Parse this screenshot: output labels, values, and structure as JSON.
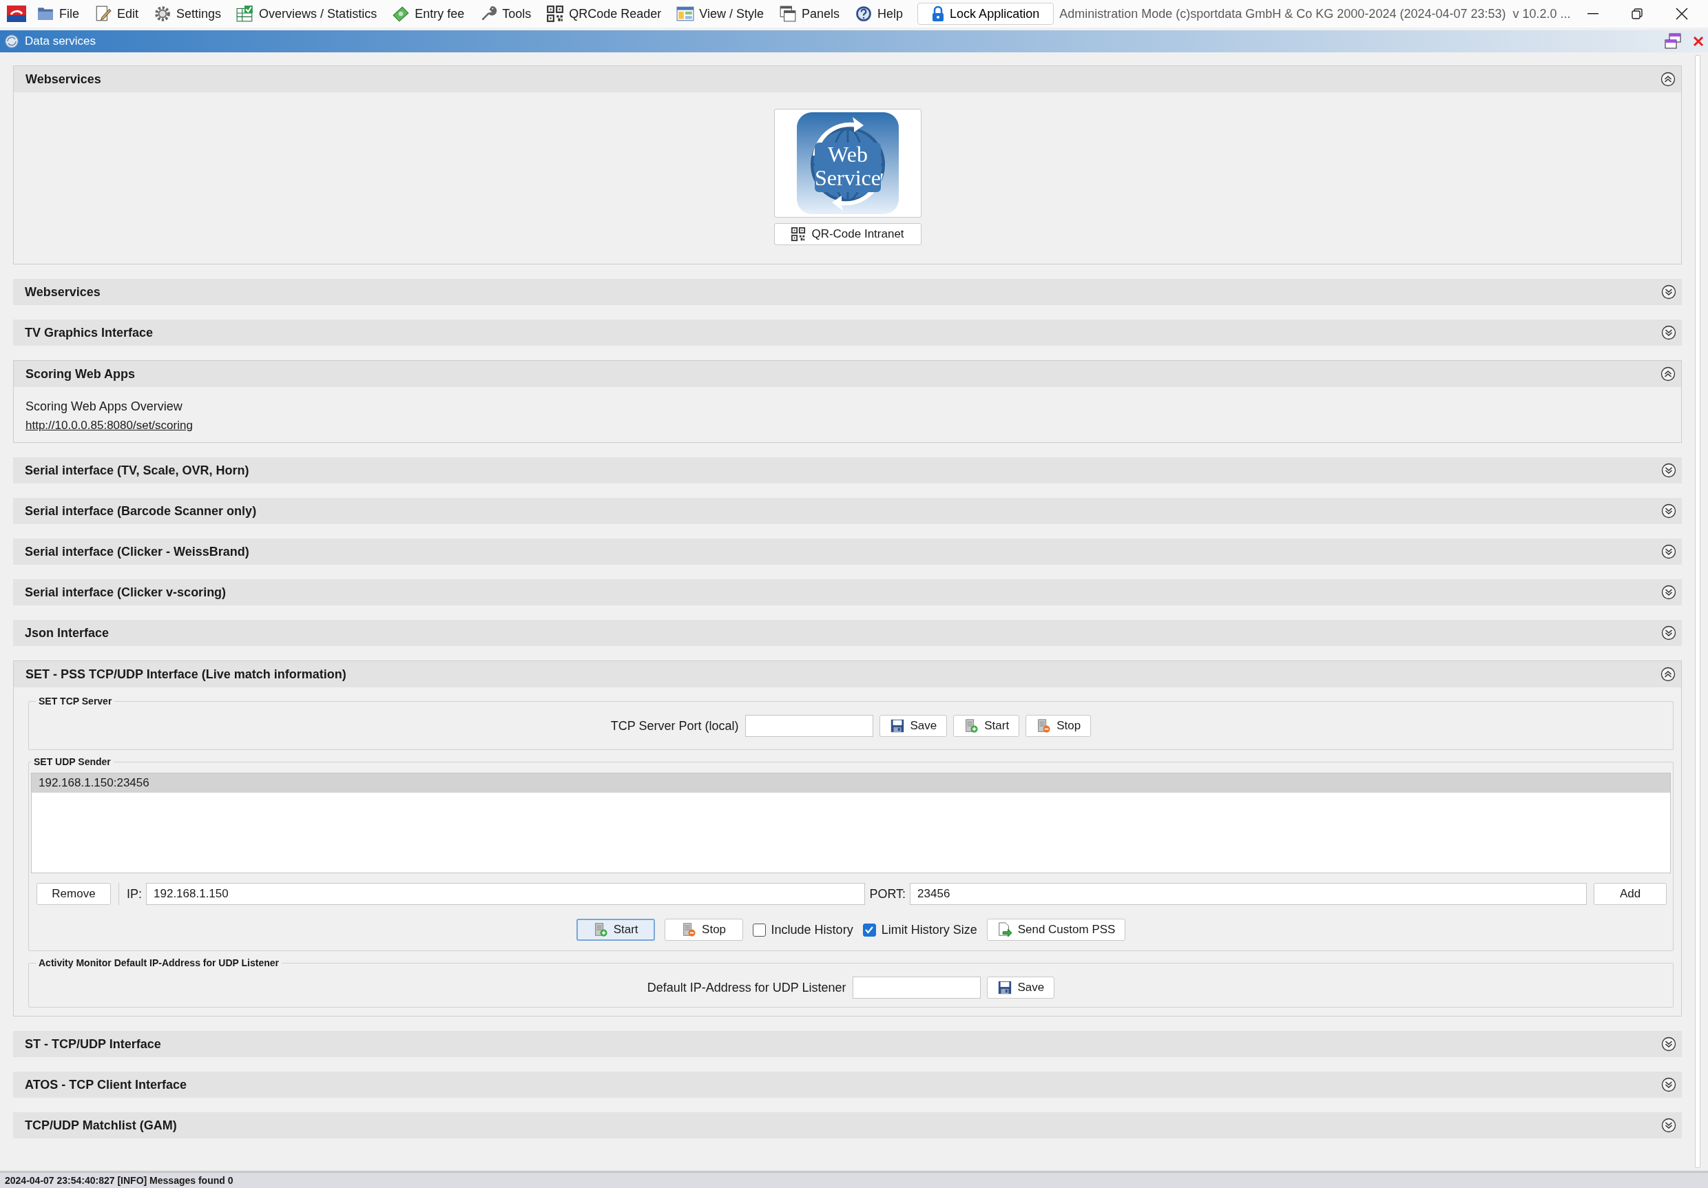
{
  "menu": [
    {
      "label": "File"
    },
    {
      "label": "Edit"
    },
    {
      "label": "Settings"
    },
    {
      "label": "Overviews / Statistics"
    },
    {
      "label": "Entry fee"
    },
    {
      "label": "Tools"
    },
    {
      "label": "QRCode Reader"
    },
    {
      "label": "View / Style"
    },
    {
      "label": "Panels"
    },
    {
      "label": "Help"
    }
  ],
  "lock_button": "Lock Application",
  "window": {
    "title": "Administration Mode (c)sportdata GmbH & Co KG 2000-2024 (2024-04-07 23:53)  v 10.2.0 ..."
  },
  "panel": {
    "title": "Data services"
  },
  "sections": [
    {
      "title": "Webservices",
      "expanded": true,
      "kind": "logo",
      "logo_lines": [
        "Web",
        "Service"
      ],
      "qr_button": "QR-Code Intranet"
    },
    {
      "title": "Webservices",
      "expanded": false
    },
    {
      "title": "TV Graphics Interface",
      "expanded": false
    },
    {
      "title": "Scoring Web Apps",
      "expanded": true,
      "kind": "links",
      "label": "Scoring Web Apps Overview",
      "link": "http://10.0.0.85:8080/set/scoring"
    },
    {
      "title": "Serial interface (TV, Scale, OVR, Horn)",
      "expanded": false
    },
    {
      "title": "Serial interface (Barcode Scanner only)",
      "expanded": false
    },
    {
      "title": "Serial interface (Clicker - WeissBrand)",
      "expanded": false
    },
    {
      "title": "Serial interface (Clicker v-scoring)",
      "expanded": false
    },
    {
      "title": "Json Interface",
      "expanded": false
    },
    {
      "title": "SET - PSS TCP/UDP Interface (Live match information)",
      "expanded": true,
      "kind": "pss",
      "tcp_server": {
        "title": "SET TCP Server",
        "port_label": "TCP Server Port (local)",
        "buttons": [
          {
            "label": "Save",
            "kind": "save"
          },
          {
            "label": "Start",
            "kind": "start"
          },
          {
            "label": "Stop",
            "kind": "stop"
          }
        ]
      },
      "udp_sender": {
        "title": "SET UDP Sender",
        "list": [
          {
            "text": "192.168.1.150:23456",
            "selected": true
          }
        ],
        "remove_button": "Remove",
        "ip_label": "IP:",
        "ip_value": "192.168.1.150",
        "port_label": "PORT:",
        "port_value": "23456",
        "add_button": "Add",
        "actions": [
          {
            "kind": "start",
            "label": "Start",
            "focused": true
          },
          {
            "kind": "stop",
            "label": "Stop",
            "focused": false
          },
          {
            "kind": "checkbox",
            "label": "Include History",
            "checked": false
          },
          {
            "kind": "checkbox",
            "label": "Limit History Size",
            "checked": true
          },
          {
            "kind": "send",
            "label": "Send Custom PSS",
            "focused": false
          }
        ]
      },
      "activity_monitor": {
        "title": "Activity Monitor Default IP-Address for UDP Listener",
        "label": "Default IP-Address for UDP Listener",
        "button": {
          "label": "Save",
          "kind": "save"
        }
      }
    },
    {
      "title": "ST - TCP/UDP Interface",
      "expanded": false
    },
    {
      "title": "ATOS - TCP Client Interface",
      "expanded": false
    },
    {
      "title": "TCP/UDP Matchlist (GAM)",
      "expanded": false
    }
  ],
  "status_bar": "2024-04-07 23:54:40:827 [INFO] Messages found 0"
}
